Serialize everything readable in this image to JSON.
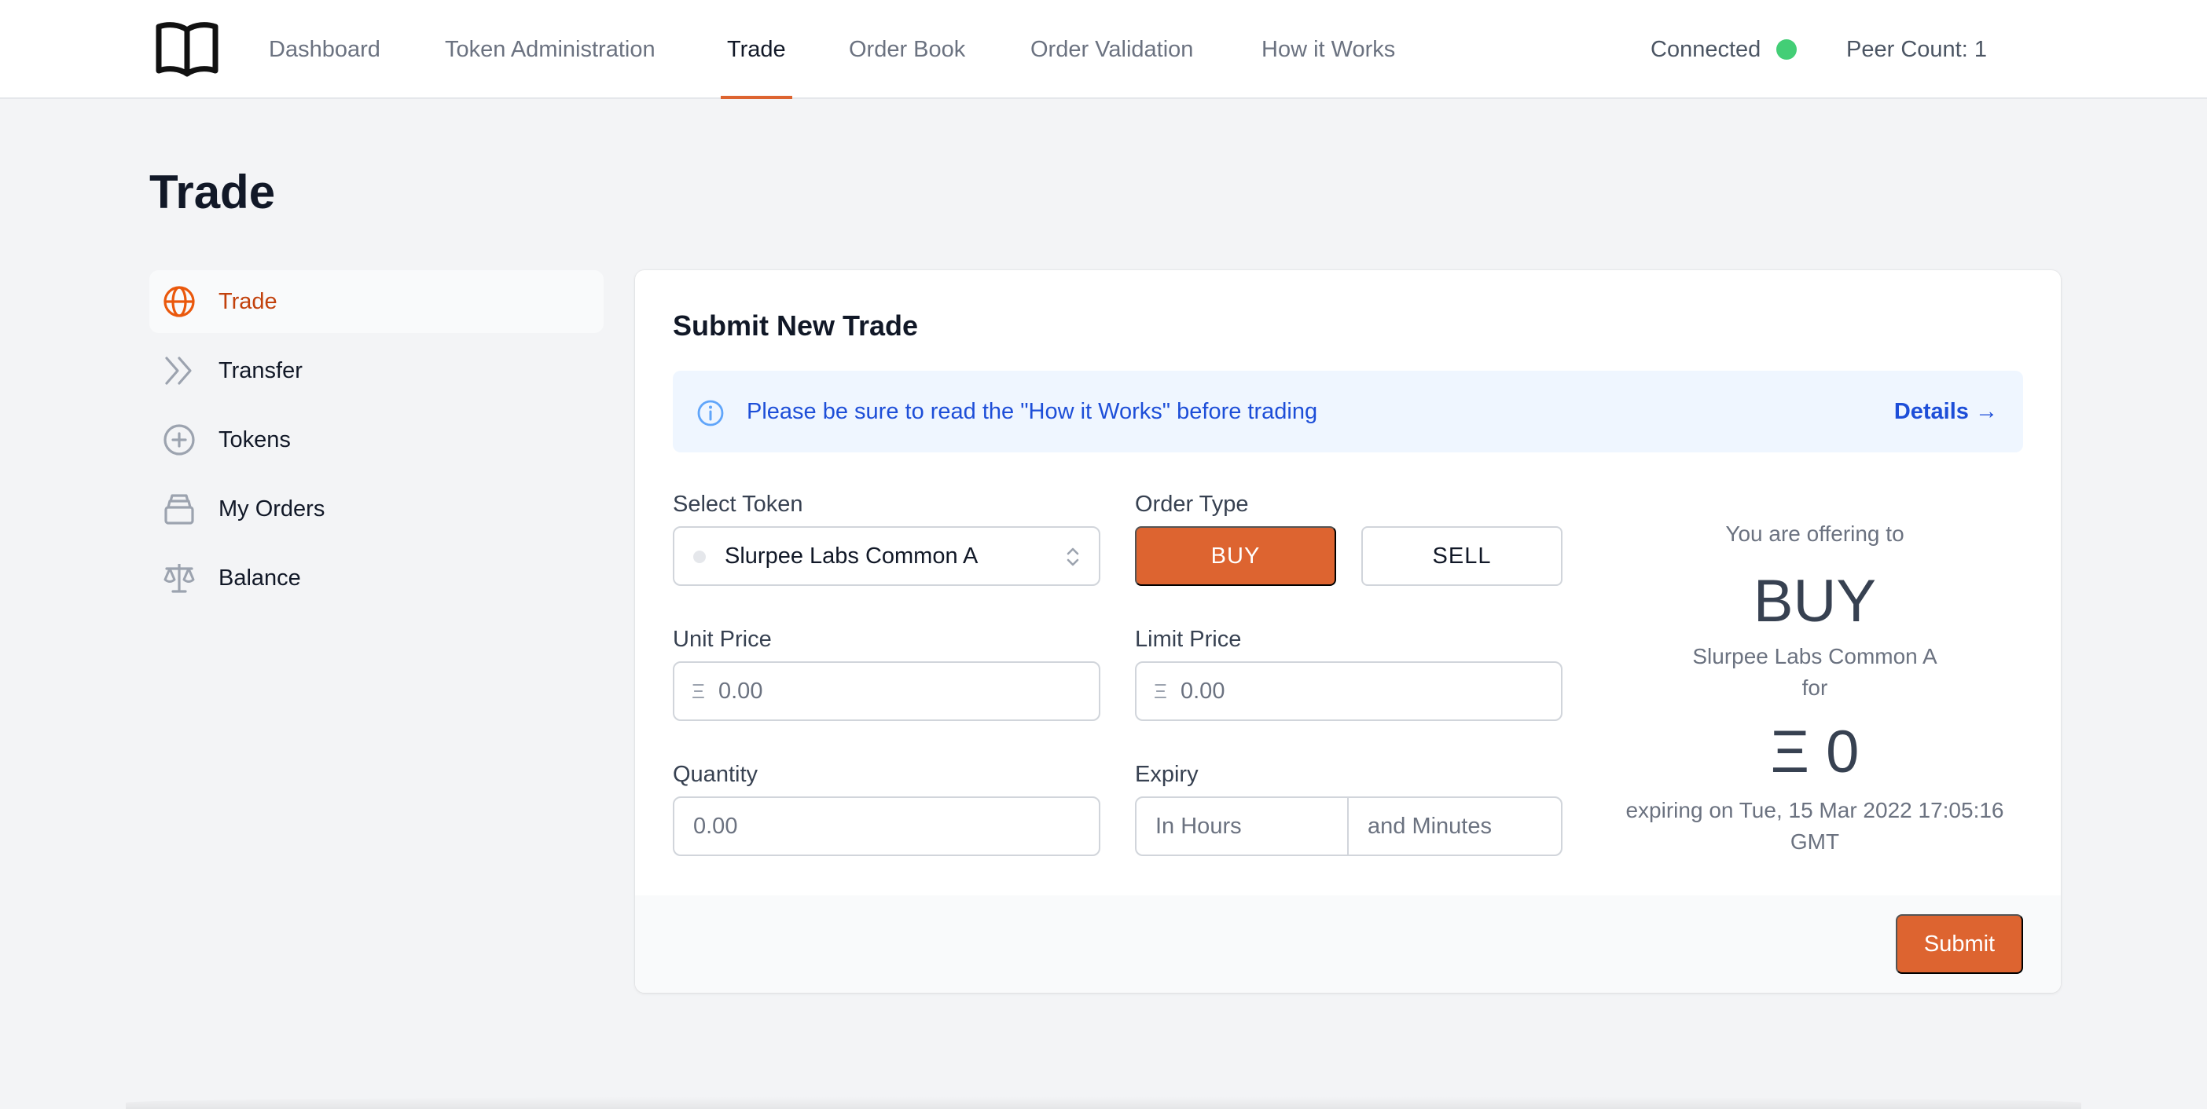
{
  "nav": {
    "items": [
      {
        "label": "Dashboard"
      },
      {
        "label": "Token Administration"
      },
      {
        "label": "Trade"
      },
      {
        "label": "Order Book"
      },
      {
        "label": "Order Validation"
      },
      {
        "label": "How it Works"
      }
    ],
    "active": "Trade",
    "status": {
      "label": "Connected",
      "color": "#22c55e"
    },
    "peer_count": "Peer Count: 1"
  },
  "page": {
    "title": "Trade"
  },
  "sidebar": {
    "items": [
      {
        "label": "Trade",
        "icon": "globe-icon"
      },
      {
        "label": "Transfer",
        "icon": "double-chevron-right-icon"
      },
      {
        "label": "Tokens",
        "icon": "plus-circle-icon"
      },
      {
        "label": "My Orders",
        "icon": "inbox-stack-icon"
      },
      {
        "label": "Balance",
        "icon": "scale-icon"
      }
    ],
    "active": "Trade"
  },
  "form": {
    "title": "Submit New Trade",
    "banner": {
      "text": "Please be sure to read the \"How it Works\" before trading",
      "link": "Details →"
    },
    "select_token": {
      "label": "Select Token",
      "value": "Slurpee Labs Common A"
    },
    "order_type": {
      "label": "Order Type",
      "buy": "BUY",
      "sell": "SELL",
      "selected": "BUY"
    },
    "unit_price": {
      "label": "Unit Price",
      "prefix": "Ξ",
      "placeholder": "0.00"
    },
    "limit_price": {
      "label": "Limit Price",
      "prefix": "Ξ",
      "placeholder": "0.00"
    },
    "quantity": {
      "label": "Quantity",
      "placeholder": "0.00"
    },
    "expiry": {
      "label": "Expiry",
      "hours_placeholder": "In Hours",
      "minutes_placeholder": "and Minutes"
    },
    "submit": "Submit"
  },
  "summary": {
    "offering": "You are offering to",
    "side": "BUY",
    "token": "Slurpee Labs Common A",
    "for": "for",
    "total": "Ξ 0",
    "expiry_line1": "expiring on Tue, 15 Mar 2022 17:05:16",
    "expiry_line2": "GMT"
  },
  "colors": {
    "accent": "#dd6430",
    "info_bg": "#eff6ff",
    "info_text": "#1d4ed8"
  }
}
